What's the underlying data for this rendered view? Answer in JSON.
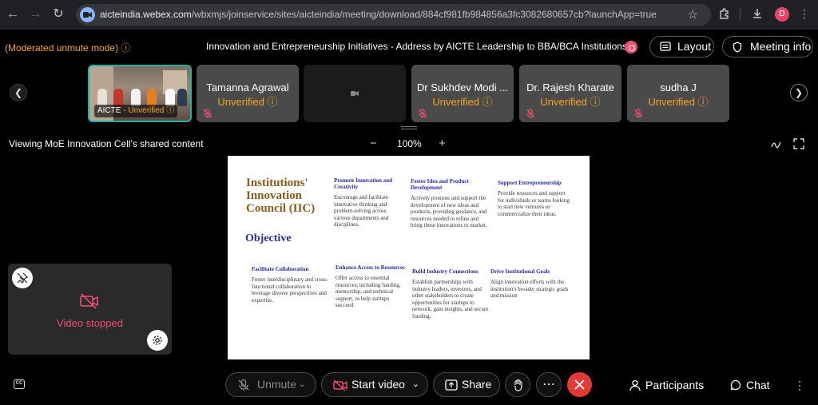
{
  "browser": {
    "url_host": "aicteindia.webex.com",
    "url_path": "/wbxmjs/joinservice/sites/aicteindia/meeting/download/884cf981fb984856a3fc3082680657cb?launchApp=true",
    "profile_initial": "D"
  },
  "header": {
    "moderated_text": "(Moderated unmute mode)",
    "meeting_title": "Innovation and Entrepreneurship Initiatives - Address by AICTE Leadership to BBA/BCA Institutions.",
    "layout_label": "Layout",
    "meeting_info_label": "Meeting info"
  },
  "participants": [
    {
      "name": "AICTE",
      "status": "Unverified",
      "type": "video"
    },
    {
      "name": "Tamanna Agrawal",
      "status": "Unverified",
      "type": "name"
    },
    {
      "name": "",
      "status": "",
      "type": "dark"
    },
    {
      "name": "Dr Sukhdev Modi ...",
      "status": "Unverified",
      "type": "name"
    },
    {
      "name": "Dr. Rajesh Kharate",
      "status": "Unverified",
      "type": "name"
    },
    {
      "name": "sudha J",
      "status": "Unverified",
      "type": "name"
    }
  ],
  "share": {
    "viewing_text": "Viewing MoE Innovation Cell's shared content",
    "zoom": "100%"
  },
  "slide": {
    "title": "Institutions' Innovation Council (IIC)",
    "objective": "Objective",
    "cards": [
      {
        "title": "Promote Innovation and Creativity",
        "body": "Encourage and facilitate innovative thinking and problem-solving across various departments and disciplines."
      },
      {
        "title": "Foster Idea and Product Development",
        "body": "Actively promote and support the development of new ideas and products, providing guidance, and resources needed to refine and bring these innovations to market."
      },
      {
        "title": "Support Entrepreneurship",
        "body": "Provide resources and support for individuals or teams looking to start new ventures or commercialize their ideas."
      },
      {
        "title": "Facilitate Collaboration",
        "body": "Foster interdisciplinary and cross-functional collaboration to leverage diverse perspectives and expertise."
      },
      {
        "title": "Enhance Access to Resources",
        "body": "Offer access to essential resources, including funding, mentorship, and technical support, to help startups succeed."
      },
      {
        "title": "Build Industry Connections",
        "body": "Establish partnerships with industry leaders, investors, and other stakeholders to create opportunities for startups to network, gain insights, and secure funding."
      },
      {
        "title": "Drive Institutional Goals",
        "body": "Align innovation efforts with the institution's broader strategic goals and mission"
      }
    ]
  },
  "selfview": {
    "status_text": "Video stopped"
  },
  "controls": {
    "unmute_label": "Unmute",
    "start_video_label": "Start video",
    "share_label": "Share",
    "participants_label": "Participants",
    "chat_label": "Chat"
  }
}
